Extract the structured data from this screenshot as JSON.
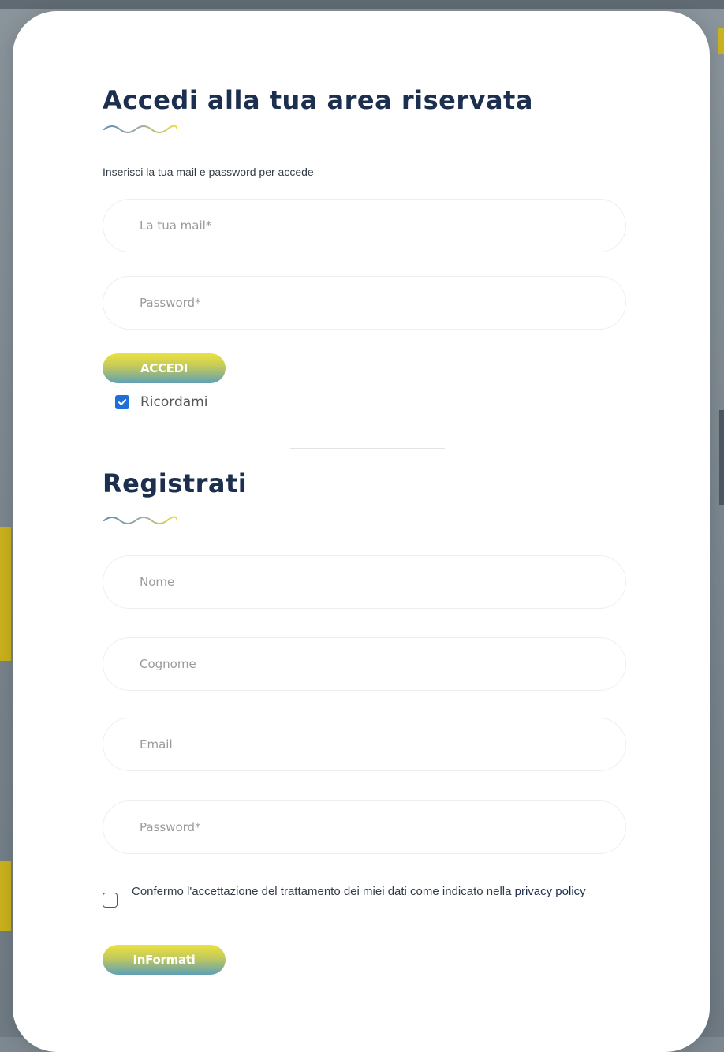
{
  "login": {
    "title": "Accedi alla tua area riservata",
    "subtitle": "Inserisci la tua mail e password per accede",
    "email_placeholder": "La tua mail*",
    "password_placeholder": "Password*",
    "submit_label": "ACCEDI",
    "remember_label": "Ricordami",
    "remember_checked": true
  },
  "register": {
    "title": "Registrati",
    "first_name_placeholder": "Nome",
    "last_name_placeholder": "Cognome",
    "email_placeholder": "Email",
    "password_placeholder": "Password*",
    "consent_text": "Confermo l'accettazione del trattamento dei miei dati come indicato nella",
    "consent_link": "privacy policy",
    "consent_checked": false,
    "submit_label": "InFormati"
  },
  "colors": {
    "title": "#1d2f4f",
    "button_gradient_top": "#ece23f",
    "button_gradient_bottom": "#5ea0b5",
    "checkbox_checked": "#1f6fd8"
  }
}
